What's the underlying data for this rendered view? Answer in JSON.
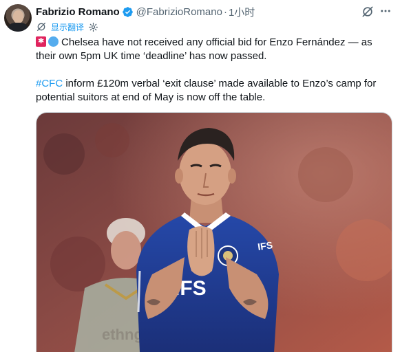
{
  "author": {
    "display_name": "Fabrizio Romano",
    "handle": "@FabrizioRomano",
    "separator": "·",
    "time": "1小时"
  },
  "icons": {
    "verified": "verified-badge-icon",
    "grok": "grok-icon",
    "more": "more-icon",
    "translate": "translate-icon",
    "settings": "gear-icon"
  },
  "translate": {
    "label": "显示翻译"
  },
  "tweet": {
    "emoji_1": "siren-emoji",
    "emoji_2": "blue-circle-emoji",
    "paragraph_1": "Chelsea have not received any official bid for Enzo Fernández — as their own 5pm UK time ‘deadline’ has now passed.",
    "hashtag": "#CFC",
    "paragraph_2": " inform £120m verbal ‘exit clause’ made available to Enzo’s camp for potential suitors at end of May is now off the table."
  },
  "photo": {
    "shirt_text": "IFS",
    "sleeve_text": "IFS"
  },
  "colors": {
    "link": "#1d9bf0",
    "verified": "#1d9bf0",
    "secondary_text": "#536471",
    "chelsea_blue": "#1f3b8f"
  }
}
